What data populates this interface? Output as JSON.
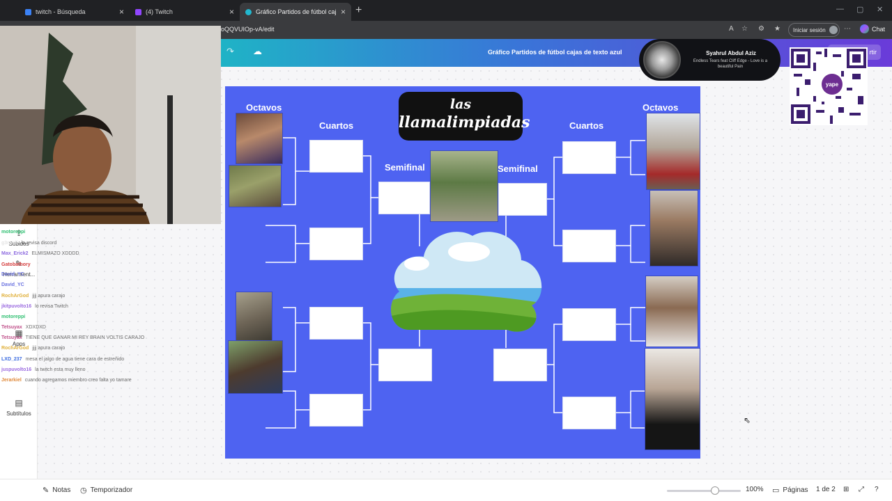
{
  "browser": {
    "tabs": [
      {
        "title": "twitch - Búsqueda",
        "active": false
      },
      {
        "title": "(4) Twitch",
        "active": false
      },
      {
        "title": "Gráfico Partidos de fútbol cajas de",
        "active": true
      }
    ],
    "url_fragment": "oQQVUIOp-vA/edit",
    "signin_label": "Iniciar sesión",
    "chat_label": "Chat"
  },
  "canva": {
    "doc_title": "Gráfico Partidos de fútbol cajas de texto azul",
    "share_label": "rtir"
  },
  "board": {
    "title_line1": "las",
    "title_line2": "llamalimpiadas",
    "labels": {
      "octavos_left": "Octavos",
      "cuartos_left": "Cuartos",
      "semifinal_left": "Semifinal",
      "semifinal_right": "Semifinal",
      "cuartos_right": "Cuartos",
      "octavos_right": "Octavos"
    }
  },
  "music": {
    "artist": "Syahrul Abdul Aziz",
    "song": "Endless Tears feat Cliff Edge - Love is a beautiful Pain"
  },
  "qr": {
    "badge": "yape"
  },
  "chat": [
    {
      "user": "motoreppi",
      "text": "",
      "color": "#2fbf71"
    },
    {
      "user": "g3rardi",
      "text": "la revisa discord",
      "color": "#e5e5e5"
    },
    {
      "user": "Max_Erick2",
      "text": "ELMISMAZO XDDDD",
      "color": "#8e6be0"
    },
    {
      "user": "Gatobathory",
      "text": "",
      "color": "#d43b3b"
    },
    {
      "user": "David_YC",
      "text": "",
      "color": "#6a72e0"
    },
    {
      "user": "David_YC",
      "text": "",
      "color": "#6a72e0"
    },
    {
      "user": "RochArGod",
      "text": "jjjj apura carajo",
      "color": "#e0b03b"
    },
    {
      "user": "jkitpuvolto16",
      "text": "lo revisa Twitch",
      "color": "#9b6be0"
    },
    {
      "user": "motoreppi",
      "text": "",
      "color": "#2fbf71"
    },
    {
      "user": "Tetsuyax",
      "text": "XDXDXD",
      "color": "#c0508a"
    },
    {
      "user": "Tetsuyax",
      "text": "TIENE QUE GANAR MI REY BRAIN VOLTIS CARAJO",
      "color": "#c0508a"
    },
    {
      "user": "RochArGod",
      "text": "jjjj apura carajo",
      "color": "#e0b03b"
    },
    {
      "user": "LXD_237",
      "text": "mesa el jalgo de agua tiene cara de estreñido",
      "color": "#3b6be0"
    },
    {
      "user": "juspuvolto16",
      "text": "la twitch esta muy lleno",
      "color": "#9b6be0"
    },
    {
      "user": "Jerarkiel",
      "text": "cuando agregamos miembro creo falta yo tamare",
      "color": "#e08a3b"
    }
  ],
  "sidebar": {
    "items": [
      {
        "label": "Subidos",
        "icon": "upload-icon"
      },
      {
        "label": "Herramient...",
        "icon": "tools-icon"
      },
      {
        "label": "Apps",
        "icon": "apps-icon"
      },
      {
        "label": "Subtítulos",
        "icon": "subtitles-icon"
      }
    ]
  },
  "bottom": {
    "notes_label": "Notas",
    "timer_label": "Temporizador",
    "zoom": "100%",
    "zoom_fraction": 0.65,
    "pages_label": "Páginas",
    "page_counter": "1 de 2"
  }
}
